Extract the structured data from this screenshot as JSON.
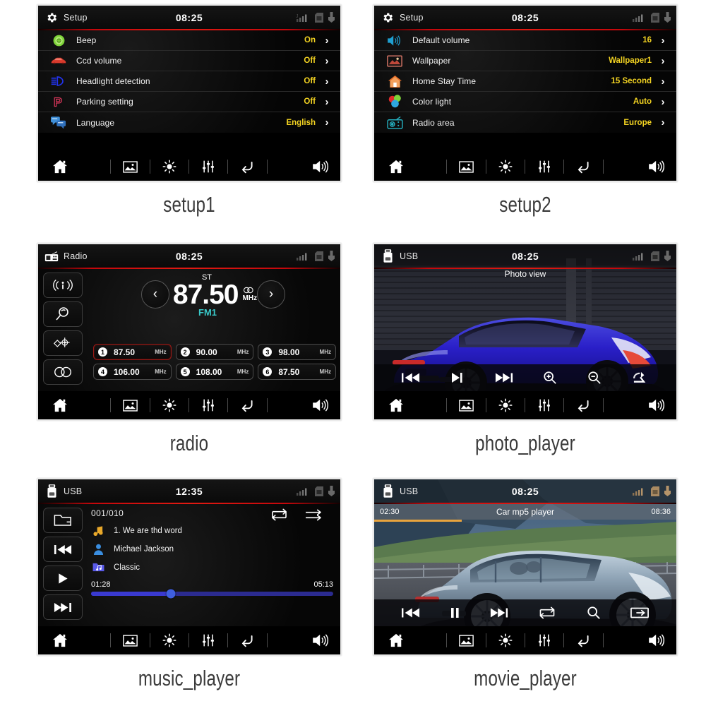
{
  "panels": [
    {
      "caption": "setup1",
      "type": "setup",
      "statusbar": {
        "icon": "gear-icon",
        "title": "Setup",
        "clock": "08:25",
        "right_icons": [
          "signal-bars-icon",
          "sd-card-icon",
          "usb-icon"
        ]
      },
      "rows": [
        {
          "icon": "beep-icon",
          "label": "Beep",
          "value": "On"
        },
        {
          "icon": "car-icon",
          "label": "Ccd volume",
          "value": "Off"
        },
        {
          "icon": "headlight-icon",
          "label": "Headlight detection",
          "value": "Off"
        },
        {
          "icon": "parking-icon",
          "label": "Parking setting",
          "value": "Off"
        },
        {
          "icon": "language-icon",
          "label": "Language",
          "value": "English"
        }
      ]
    },
    {
      "caption": "setup2",
      "type": "setup",
      "statusbar": {
        "icon": "gear-icon",
        "title": "Setup",
        "clock": "08:25",
        "right_icons": [
          "signal-bars-icon",
          "sd-card-icon",
          "usb-icon"
        ]
      },
      "rows": [
        {
          "icon": "speaker-icon",
          "label": "Default volume",
          "value": "16"
        },
        {
          "icon": "wallpaper-icon",
          "label": "Wallpaper",
          "value": "Wallpaper1"
        },
        {
          "icon": "home-icon",
          "label": "Home Stay Time",
          "value": "15 Second"
        },
        {
          "icon": "colorlight-icon",
          "label": "Color light",
          "value": "Auto"
        },
        {
          "icon": "radio-icon",
          "label": "Radio area",
          "value": "Europe"
        }
      ]
    },
    {
      "caption": "radio",
      "type": "radio",
      "statusbar": {
        "icon": "radio-icon",
        "title": "Radio",
        "clock": "08:25",
        "right_icons": [
          "signal-bars-icon",
          "sd-card-icon",
          "usb-icon"
        ]
      },
      "stereo_label": "ST",
      "frequency": "87.50",
      "unit": "MHz",
      "band": "FM1",
      "prev_label": "‹",
      "next_label": "›",
      "side_buttons": [
        "band-antenna-icon",
        "scan-search-icon",
        "dx-local-icon",
        "stereo-icon"
      ],
      "presets": [
        {
          "num": "1",
          "freq": "87.50",
          "unit": "MHz",
          "active": true
        },
        {
          "num": "2",
          "freq": "90.00",
          "unit": "MHz",
          "active": false
        },
        {
          "num": "3",
          "freq": "98.00",
          "unit": "MHz",
          "active": false
        },
        {
          "num": "4",
          "freq": "106.00",
          "unit": "MHz",
          "active": false
        },
        {
          "num": "5",
          "freq": "108.00",
          "unit": "MHz",
          "active": false
        },
        {
          "num": "6",
          "freq": "87.50",
          "unit": "MHz",
          "active": false
        }
      ]
    },
    {
      "caption": "photo_player",
      "type": "photo",
      "statusbar": {
        "icon": "usb-device-icon",
        "title": "USB",
        "clock": "08:25",
        "right_icons": [
          "signal-bars-icon",
          "sd-card-icon",
          "usb-icon"
        ]
      },
      "title": "Photo view",
      "controls": [
        "prev-track-icon",
        "play-pause-icon",
        "next-track-icon",
        "zoom-in-icon",
        "zoom-out-icon",
        "rotate-icon"
      ]
    },
    {
      "caption": "music_player",
      "type": "music",
      "statusbar": {
        "icon": "usb-device-icon",
        "title": "USB",
        "clock": "12:35",
        "right_icons": [
          "signal-bars-icon",
          "sd-card-icon",
          "usb-icon"
        ]
      },
      "side_buttons": [
        "folder-icon",
        "prev-track-icon",
        "play-icon",
        "next-track-icon"
      ],
      "track_count": "001/010",
      "mode_icons": [
        "repeat-icon",
        "shuffle-icon"
      ],
      "meta": [
        {
          "icon": "music-note-icon",
          "text": "1. We are thd word"
        },
        {
          "icon": "artist-icon",
          "text": "Michael Jackson"
        },
        {
          "icon": "genre-icon",
          "text": "Classic"
        }
      ],
      "time_elapsed": "01:28",
      "time_total": "05:13",
      "progress_percent": 33
    },
    {
      "caption": "movie_player",
      "type": "movie",
      "statusbar": {
        "icon": "usb-device-icon",
        "title": "USB",
        "clock": "08:25",
        "right_icons": [
          "signal-bars-icon",
          "sd-card-icon",
          "usb-icon"
        ]
      },
      "title": "Car mp5 player",
      "time_elapsed": "02:30",
      "time_total": "08:36",
      "progress_percent": 29,
      "controls": [
        "prev-track-icon",
        "pause-icon",
        "next-track-icon",
        "repeat-icon",
        "search-icon",
        "screen-switch-icon"
      ]
    }
  ],
  "bottombar": {
    "items": [
      "home-icon",
      "wallpaper-icon",
      "brightness-icon",
      "equalizer-icon",
      "back-icon",
      "volume-icon"
    ]
  }
}
